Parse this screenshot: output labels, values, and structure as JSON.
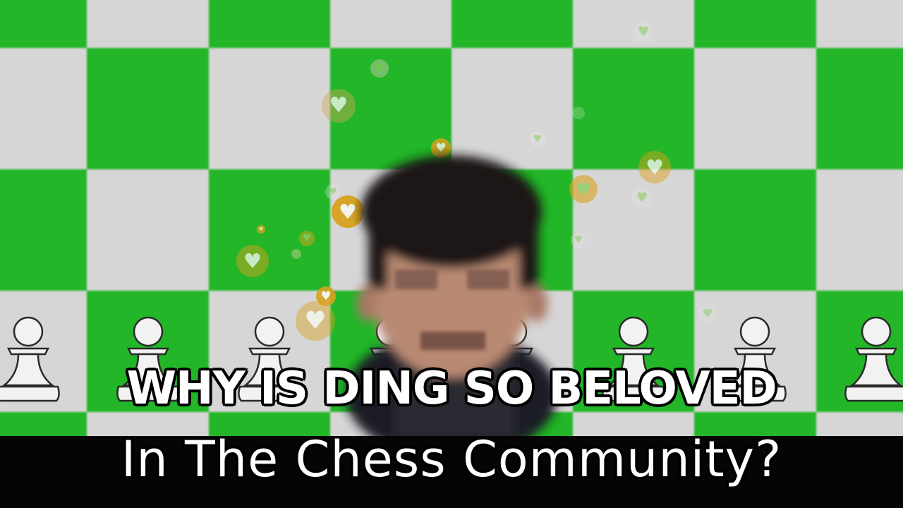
{
  "video_frame": {
    "caption_line1": "WHY IS DING SO BELOVED",
    "caption_line2": "In The Chess Community?"
  },
  "colors": {
    "board_green": "#22b628",
    "board_light": "#d6d6d6",
    "heart_gold": "#d8a21e",
    "heart_fill": "#8fcf6a"
  },
  "icons": [
    "pawn-icon",
    "heart-icon"
  ]
}
